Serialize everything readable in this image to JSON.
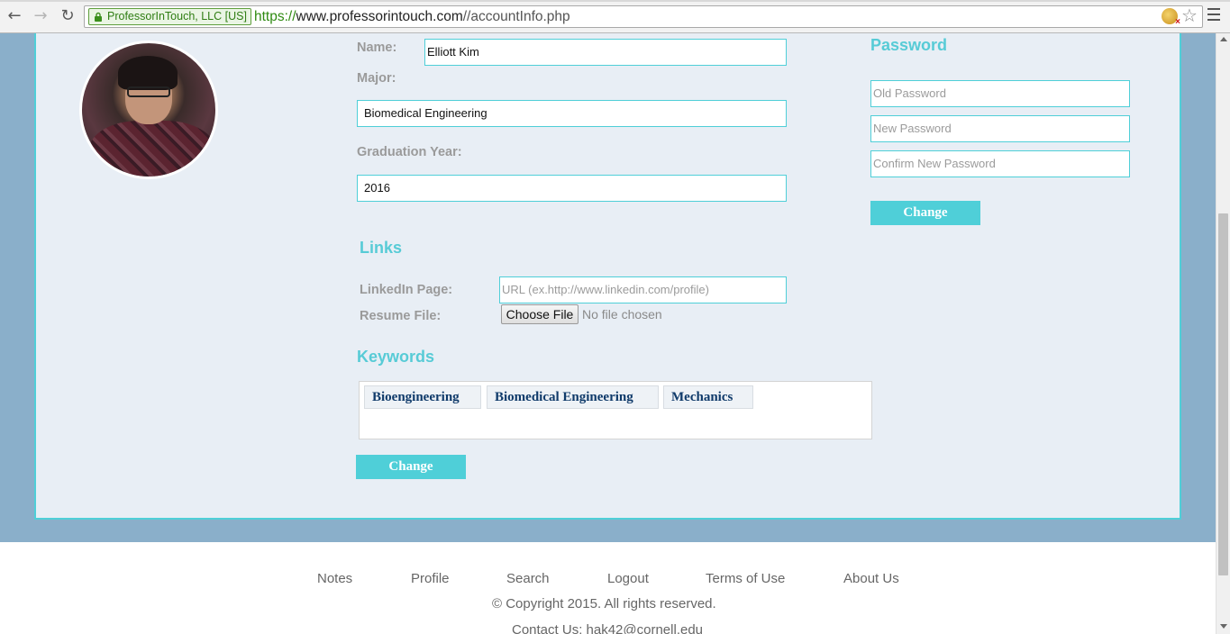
{
  "browser": {
    "ev_label": "ProfessorInTouch, LLC [US]",
    "url_scheme": "https://",
    "url_host": "www.professorintouch.com",
    "url_path": "//accountInfo.php"
  },
  "profile": {
    "name_label": "Name:",
    "name_value": "Elliott Kim",
    "major_label": "Major:",
    "major_value": "Biomedical Engineering",
    "grad_label": "Graduation Year:",
    "grad_value": "2016"
  },
  "links": {
    "title": "Links",
    "linkedin_label": "LinkedIn Page:",
    "linkedin_placeholder": "URL (ex.http://www.linkedin.com/profile)",
    "resume_label": "Resume File:",
    "file_button": "Choose File",
    "file_status": "No file chosen"
  },
  "keywords": {
    "title": "Keywords",
    "items": [
      "Bioengineering",
      "Biomedical Engineering",
      "Mechanics"
    ],
    "change_label": "Change"
  },
  "password": {
    "title": "Password",
    "old_placeholder": "Old Password",
    "new_placeholder": "New Password",
    "confirm_placeholder": "Confirm New Password",
    "change_label": "Change"
  },
  "footer": {
    "links": [
      "Notes",
      "Profile",
      "Search",
      "Logout",
      "Terms of Use",
      "About Us"
    ],
    "copyright": "© Copyright 2015. All rights reserved.",
    "contact": "Contact Us: hak42@cornell.edu"
  },
  "colors": {
    "accent": "#4fcfd8",
    "band": "#8aafca",
    "card": "#e8eef5",
    "keyword_text": "#0f3a6a"
  }
}
